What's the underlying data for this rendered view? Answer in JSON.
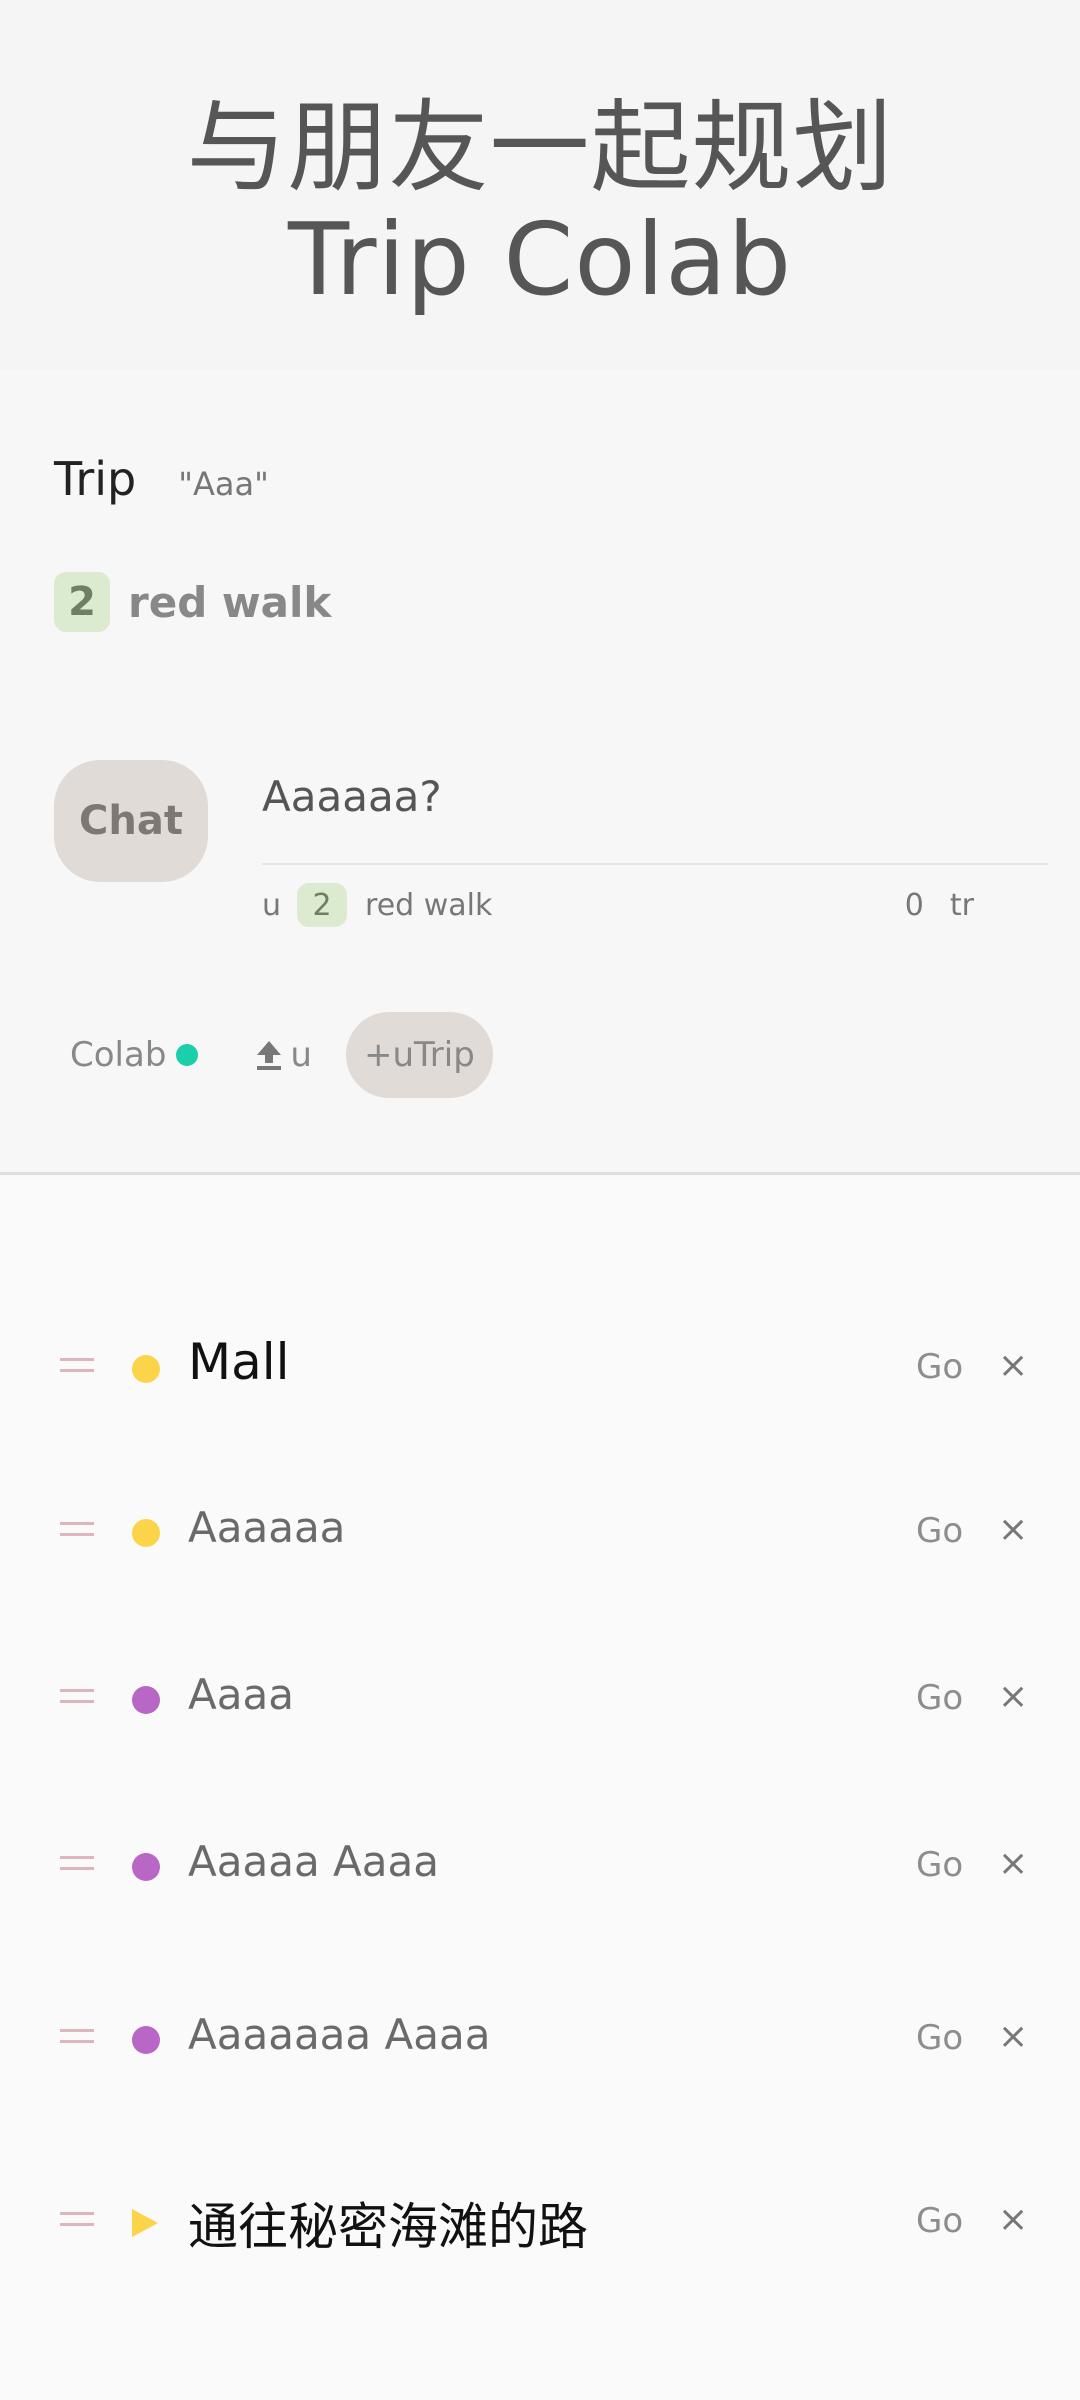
{
  "hero": {
    "line1": "与朋友一起规划",
    "line2": "Trip Colab"
  },
  "trip": {
    "label": "Trip",
    "quote": "\"Aaa\"",
    "badge": "2",
    "route": "red walk"
  },
  "chat": {
    "button_label": "Chat",
    "message": "Aaaaaa?",
    "meta_prefix": "u",
    "meta_badge": "2",
    "meta_route": "red walk",
    "meta_count": "0",
    "meta_suffix": "tr"
  },
  "actions": {
    "colab_label": "Colab",
    "colab_status_color": "#1ccfab",
    "upload_label": "u",
    "add_trip_label": "+uTrip"
  },
  "items": [
    {
      "title": "Mall",
      "marker": "dot",
      "color": "#fcd44a",
      "go": "Go",
      "close": "×"
    },
    {
      "title": "Aaaaaa",
      "marker": "dot",
      "color": "#fcd44a",
      "go": "Go",
      "close": "×"
    },
    {
      "title": "Aaaa",
      "marker": "dot",
      "color": "#b867c6",
      "go": "Go",
      "close": "×"
    },
    {
      "title": "Aaaaa Aaaa",
      "marker": "dot",
      "color": "#b867c6",
      "go": "Go",
      "close": "×"
    },
    {
      "title": "Aaaaaaa Aaaa",
      "marker": "dot",
      "color": "#b867c6",
      "go": "Go",
      "close": "×"
    },
    {
      "title": "通往秘密海滩的路",
      "marker": "triangle",
      "color": "#fcd44a",
      "go": "Go",
      "close": "×"
    }
  ]
}
